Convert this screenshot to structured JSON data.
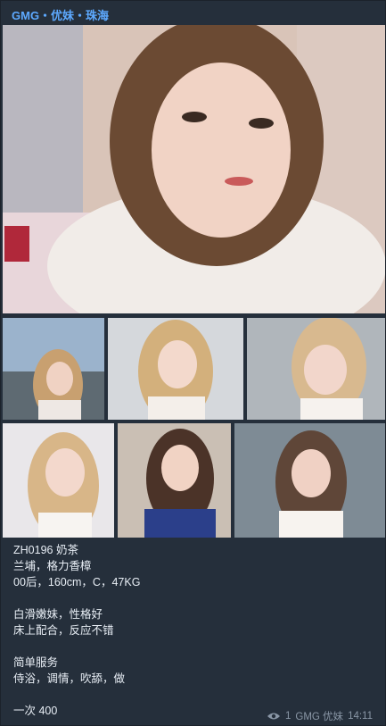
{
  "message": {
    "sender": "GMG・优妹・珠海",
    "text_lines": {
      "l1": "ZH0196 奶茶",
      "l2": "兰埔，格力香樟",
      "l3": "00后，160cm，C，47KG",
      "l4": "白滑嫩妹，性格好",
      "l5": "床上配合，反应不错",
      "l6": "简单服务",
      "l7": "侍浴，调情，吹舔，做",
      "l8": "一次 400"
    },
    "views": "1",
    "signature": "GMG 优妹",
    "time": "14:11",
    "view_icon": "eye-icon"
  },
  "colors": {
    "sender": "#5da9ff",
    "bubble": "#252f3b",
    "meta": "#8a97a6"
  }
}
